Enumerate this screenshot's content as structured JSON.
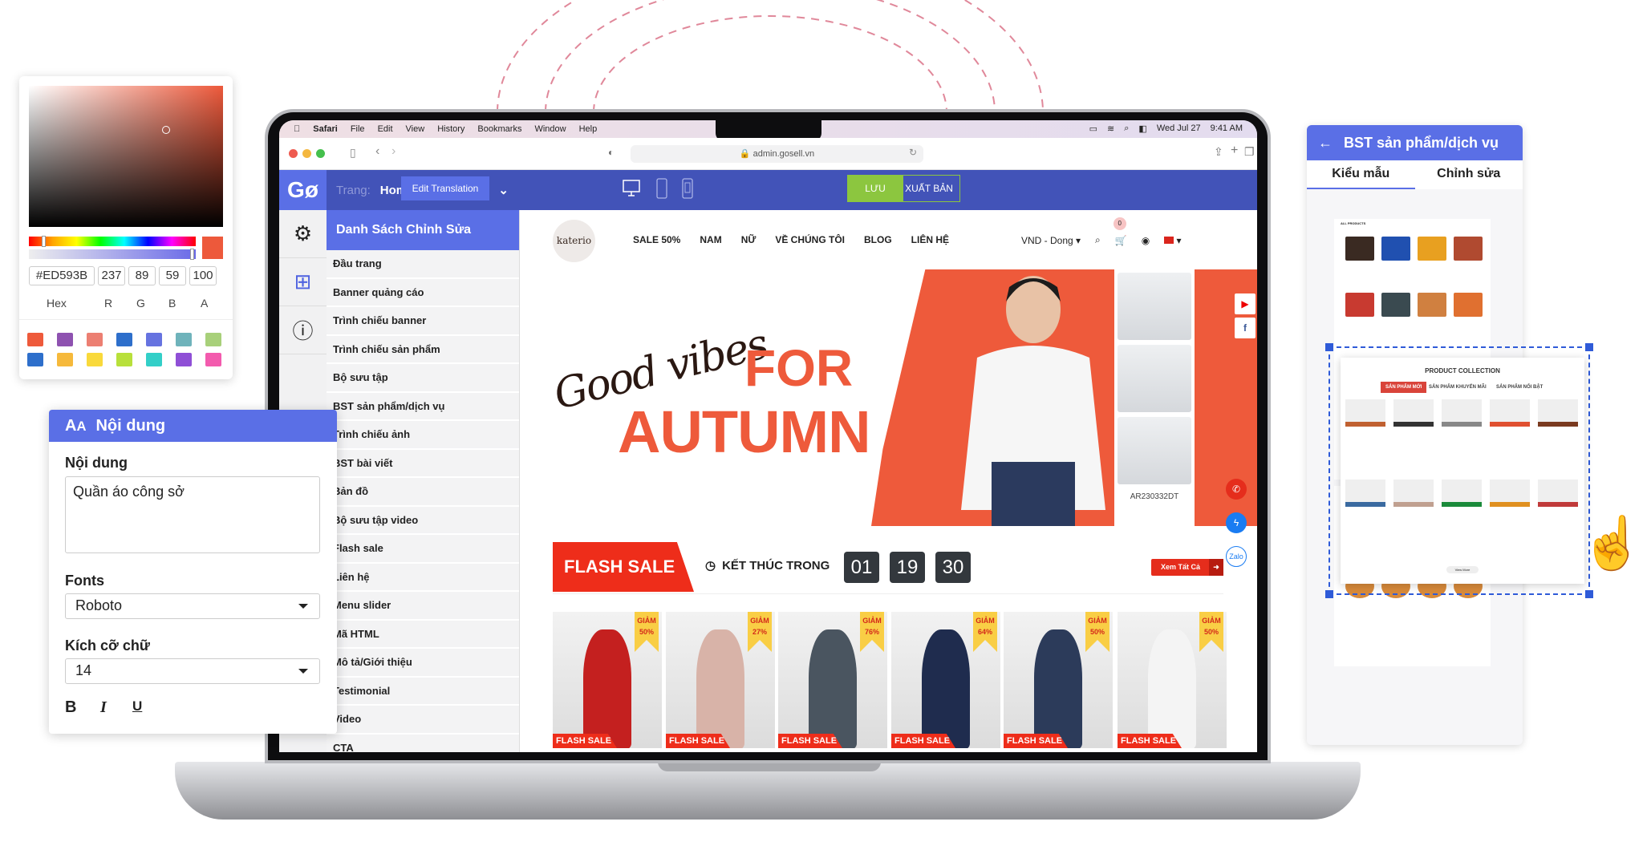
{
  "menubar": {
    "app": "Safari",
    "items": [
      "File",
      "Edit",
      "View",
      "History",
      "Bookmarks",
      "Window",
      "Help"
    ],
    "date": "Wed Jul 27",
    "time": "9:41 AM"
  },
  "browser": {
    "url": "admin.gosell.vn"
  },
  "editor": {
    "logo": "Gø",
    "page_label": "Trang:",
    "page_value": "Homepage",
    "edit_translation": "Edit Translation",
    "save": "LƯU",
    "publish": "XUẤT BẢN",
    "sidebar_title": "Danh Sách Chỉnh Sửa",
    "sidebar_items": [
      "Đầu trang",
      "Banner quảng cáo",
      "Trình chiếu banner",
      "Trình chiếu sản phẩm",
      "Bộ sưu tập",
      "BST sản phẩm/dịch vụ",
      "Trình chiếu ảnh",
      "BST bài viết",
      "Bản đồ",
      "Bộ sưu tập video",
      "Flash sale",
      "Liên hệ",
      "Menu slider",
      "Mã HTML",
      "Mô tả/Giới thiệu",
      "Testimonial",
      "Video",
      "CTA"
    ]
  },
  "store": {
    "logo": "katerio",
    "nav": [
      "SALE 50%",
      "NAM",
      "NỮ",
      "VỀ CHÚNG TÔI",
      "BLOG",
      "LIÊN HỆ"
    ],
    "currency": "VND - Dong",
    "cart_count": "0",
    "hero": {
      "script": "Good vibes",
      "line1": "FOR",
      "line2": "AUTUMN",
      "sku": "AR230332DT"
    },
    "zalo": "Zalo",
    "flash": {
      "title": "FLASH SALE",
      "ends_in": "KẾT THÚC TRONG",
      "hours": "01",
      "minutes": "19",
      "seconds": "30",
      "see_all": "Xem Tất Cả",
      "badge_label": "GIẢM",
      "products": [
        {
          "discount": "50%",
          "color": "#c4201f"
        },
        {
          "discount": "27%",
          "color": "#d8b3a8"
        },
        {
          "discount": "76%",
          "color": "#4a5560"
        },
        {
          "discount": "64%",
          "color": "#1f2c4e"
        },
        {
          "discount": "50%",
          "color": "#2c3b5a"
        },
        {
          "discount": "50%",
          "color": "#f4f4f4"
        }
      ]
    }
  },
  "color_picker": {
    "hex": "#ED593B",
    "r": "237",
    "g": "89",
    "b": "59",
    "a": "100",
    "labels": [
      "Hex",
      "R",
      "G",
      "B",
      "A"
    ],
    "swatches": [
      "#ee5a3b",
      "#8e52b0",
      "#ec7f72",
      "#2e6fcb",
      "#6673e0",
      "#6fb3bb",
      "#a8d07a",
      "#2e6fcb",
      "#f6b93b",
      "#f9d93b",
      "#b8e03b",
      "#33cfc8",
      "#8f4fd6",
      "#f35bae"
    ]
  },
  "content_panel": {
    "title": "Nội dung",
    "content_label": "Nội dung",
    "content_value": "Quần áo công sở",
    "fonts_label": "Fonts",
    "font_value": "Roboto",
    "size_label": "Kích cỡ chữ",
    "size_value": "14",
    "bold": "B",
    "italic": "I",
    "underline": "U"
  },
  "collection_panel": {
    "title": "BST sản phẩm/dịch vụ",
    "tabs": [
      "Kiểu mẫu",
      "Chỉnh sửa"
    ],
    "active_tab": 0,
    "template_heading": "ALL PRODUCTS",
    "selected": {
      "title": "PRODUCT COLLECTION",
      "tabs": [
        "SẢN PHẨM MỚI",
        "SẢN PHẨM KHUYẾN MÃI",
        "SẢN PHẨM NỔI BẬT"
      ],
      "view_more": "View More"
    }
  },
  "colors": {
    "brand_blue": "#5a6fe6",
    "topbar": "#4253b8",
    "accent_orange": "#ee5a3b",
    "flash_red": "#ee2d1a",
    "save_green": "#8cc63f"
  }
}
